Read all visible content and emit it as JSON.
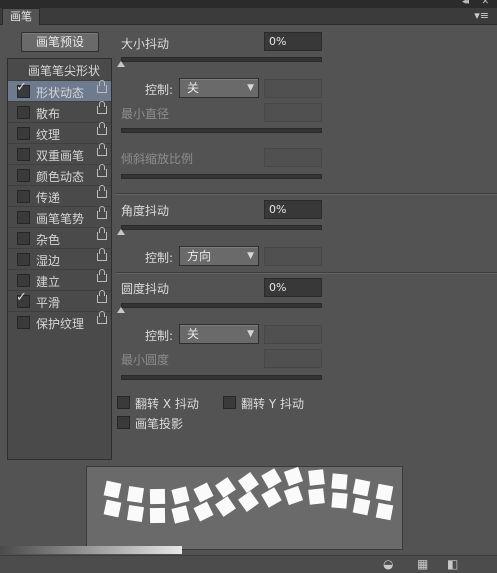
{
  "panel": {
    "tab_label": "画笔",
    "collapse_glyph": "◂◂",
    "close_glyph": "✕",
    "menu_glyph": "▾≡"
  },
  "preset_button": "画笔预设",
  "brush_list": {
    "header": "画笔笔尖形状",
    "items": [
      {
        "label": "形状动态",
        "checked": true,
        "selected": true
      },
      {
        "label": "散布",
        "checked": false
      },
      {
        "label": "纹理",
        "checked": false
      },
      {
        "label": "双重画笔",
        "checked": false
      },
      {
        "label": "颜色动态",
        "checked": false
      },
      {
        "label": "传递",
        "checked": false
      },
      {
        "label": "画笔笔势",
        "checked": false
      },
      {
        "label": "杂色",
        "checked": false
      },
      {
        "label": "湿边",
        "checked": false
      },
      {
        "label": "建立",
        "checked": false
      },
      {
        "label": "平滑",
        "checked": true
      },
      {
        "label": "保护纹理",
        "checked": false
      }
    ]
  },
  "size_jitter": {
    "label": "大小抖动",
    "value": "0%",
    "control_label": "控制:",
    "control_value": "关",
    "min_diameter_label": "最小直径",
    "tilt_scale_label": "倾斜缩放比例"
  },
  "angle_jitter": {
    "label": "角度抖动",
    "value": "0%",
    "control_label": "控制:",
    "control_value": "方向"
  },
  "roundness_jitter": {
    "label": "圆度抖动",
    "value": "0%",
    "control_label": "控制:",
    "control_value": "关",
    "min_roundness_label": "最小圆度"
  },
  "options": {
    "flip_x": "翻转 X 抖动",
    "flip_y": "翻转 Y 抖动",
    "brush_projection": "画笔投影"
  },
  "icons": {
    "check": "✓",
    "dropdown": "▼",
    "bottom_toggle": "toggle-icon",
    "bottom_grid": "grid-icon",
    "bottom_new": "new-preset-icon"
  }
}
